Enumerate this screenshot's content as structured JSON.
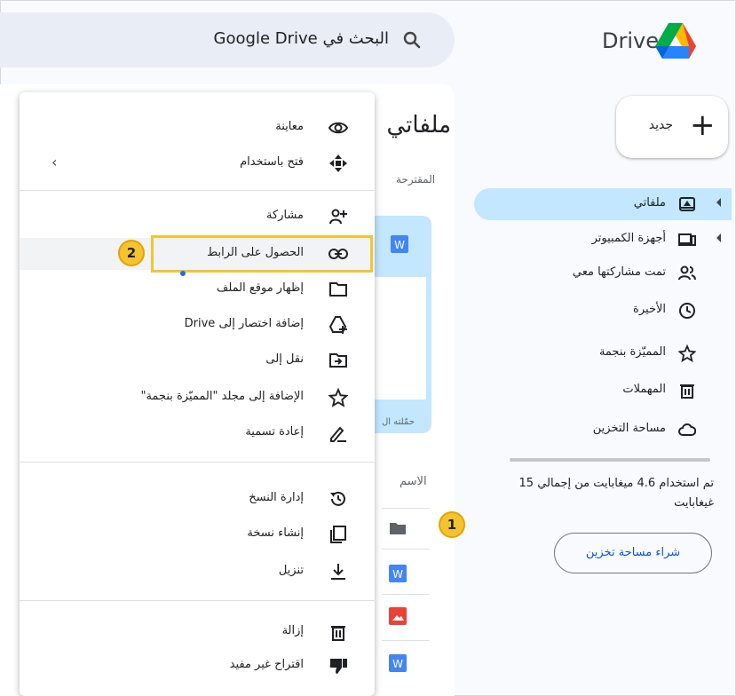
{
  "header": {
    "app_name": "Drive",
    "search_text": "البحث في Google Drive"
  },
  "main": {
    "title": "ملفاتي",
    "suggested_label": "المقترحة",
    "card_footer": "حمّلته ال",
    "name_column": "الاسم"
  },
  "sidebar": {
    "new_label": "جديد",
    "items": [
      {
        "label": "ملفاتي",
        "icon": "my-drive-icon",
        "active": true
      },
      {
        "label": "أجهزة الكمبيوتر",
        "icon": "computers-icon"
      },
      {
        "label": "تمت مشاركتها معي",
        "icon": "shared-icon"
      },
      {
        "label": "الأخيرة",
        "icon": "recent-icon"
      },
      {
        "label": "المميّزة بنجمة",
        "icon": "star-icon"
      },
      {
        "label": "المهملات",
        "icon": "trash-icon"
      },
      {
        "label": "مساحة التخزين",
        "icon": "cloud-icon"
      }
    ],
    "storage_text": "تم استخدام 4.6 ميغابايت من إجمالي 15 غيغابايت",
    "buy_storage": "شراء مساحة تخزين"
  },
  "context_menu": {
    "items": [
      {
        "label": "معاينة",
        "icon": "eye-icon"
      },
      {
        "label": "فتح باستخدام",
        "icon": "open-with-icon"
      },
      {
        "label": "مشاركة",
        "icon": "share-icon"
      },
      {
        "label": "الحصول على الرابط",
        "icon": "link-icon"
      },
      {
        "label": "إظهار موقع الملف",
        "icon": "folder-icon"
      },
      {
        "label": "إضافة اختصار إلى Drive",
        "icon": "add-shortcut-icon"
      },
      {
        "label": "نقل إلى",
        "icon": "move-icon"
      },
      {
        "label": "الإضافة إلى مجلد \"المميّزة بنجمة\"",
        "icon": "star-icon"
      },
      {
        "label": "إعادة تسمية",
        "icon": "rename-icon"
      },
      {
        "label": "إدارة النسخ",
        "icon": "history-icon"
      },
      {
        "label": "إنشاء نسخة",
        "icon": "copy-icon"
      },
      {
        "label": "تنزيل",
        "icon": "download-icon"
      },
      {
        "label": "إزالة",
        "icon": "trash-icon"
      },
      {
        "label": "اقتراح غير مفيد",
        "icon": "thumbs-down-icon"
      }
    ]
  },
  "callouts": {
    "one": "1",
    "two": "2"
  },
  "colors": {
    "accent_blue": "#c2e7ff",
    "highlight_yellow": "#f4c430"
  }
}
